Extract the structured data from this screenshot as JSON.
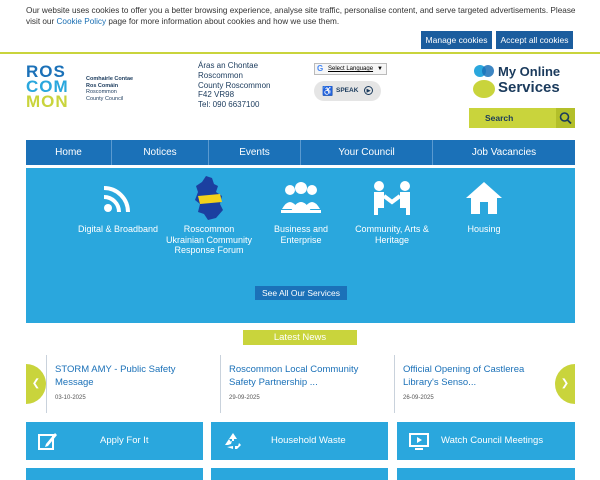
{
  "cookie": {
    "text_before": "Our website uses cookies to offer you a better browsing experience, analyse site traffic, personalise content, and serve targeted advertisements. Please visit our ",
    "link": "Cookie Policy",
    "text_after": " page for more information about cookies and how we use them.",
    "manage_label": "Manage cookies",
    "accept_label": "Accept all cookies"
  },
  "logo": {
    "word1": "ROS",
    "word2": "COM",
    "word3": "MON",
    "sub1": "Comhairle Contae",
    "sub2": "Ros Comáin",
    "sub3": "Roscommon",
    "sub4": "County Council"
  },
  "address": {
    "line1": "Áras an Chontae",
    "line2": "Roscommon",
    "line3": "County Roscommon",
    "line4": "F42 VR98",
    "line5": "Tel: 090 6637100"
  },
  "language": {
    "label": "Select Language"
  },
  "speak": {
    "label": "SPEAK"
  },
  "my_online_services": {
    "line1": "My Online",
    "line2": "Services"
  },
  "search": {
    "label": "Search"
  },
  "nav": [
    "Home",
    "Notices",
    "Events",
    "Your Council",
    "Job Vacancies"
  ],
  "services": [
    {
      "label": "Digital & Broadband",
      "icon": "wifi-icon"
    },
    {
      "label": "Roscommon Ukrainian Community Response Forum",
      "icon": "ukraine-map-icon"
    },
    {
      "label": "Business and Enterprise",
      "icon": "people-group-icon"
    },
    {
      "label": "Community, Arts & Heritage",
      "icon": "handshake-icon"
    },
    {
      "label": "Housing",
      "icon": "house-icon"
    }
  ],
  "see_all": "See All Our Services",
  "news": {
    "title": "Latest News",
    "items": [
      {
        "headline": "STORM AMY - Public Safety Message",
        "date": "03-10-2025"
      },
      {
        "headline": "Roscommon Local Community Safety Partnership ...",
        "date": "29-09-2025"
      },
      {
        "headline": "Official Opening of Castlerea Library's Senso...",
        "date": "26-09-2025"
      }
    ]
  },
  "quick_links": [
    {
      "label": "Apply For It",
      "icon": "edit-icon"
    },
    {
      "label": "Household Waste",
      "icon": "recycle-icon"
    },
    {
      "label": "Watch Council Meetings",
      "icon": "video-icon"
    }
  ],
  "colors": {
    "brand_blue": "#1b71b8",
    "hero_blue": "#2aa7dd",
    "accent_green": "#c9d43c"
  }
}
